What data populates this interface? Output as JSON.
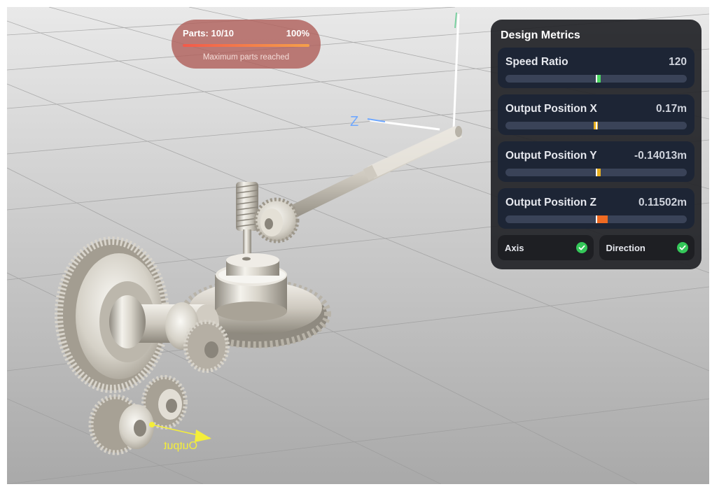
{
  "parts": {
    "label": "Parts: 10/10",
    "percent_label": "100%",
    "fill_fraction": 1.0,
    "message": "Maximum parts reached"
  },
  "metrics": {
    "title": "Design Metrics",
    "items": [
      {
        "label": "Speed Ratio",
        "value": "120",
        "indicator": 0.03,
        "color": "#4cd964"
      },
      {
        "label": "Output Position X",
        "value": "0.17m",
        "indicator": -0.03,
        "color": "#e8b020"
      },
      {
        "label": "Output Position Y",
        "value": "-0.14013m",
        "indicator": 0.03,
        "color": "#e8b020"
      },
      {
        "label": "Output Position Z",
        "value": "0.11502m",
        "indicator": 0.13,
        "color": "#ef6a22"
      }
    ],
    "checks": [
      {
        "label": "Axis",
        "status": "ok"
      },
      {
        "label": "Direction",
        "status": "ok"
      }
    ]
  },
  "scene": {
    "output_label": "Output",
    "axis_label": "Z"
  },
  "colors": {
    "pill_bg": "#b0605c",
    "panel_bg": "#222428",
    "check_green": "#34c759",
    "output_arrow": "#f4ee3a"
  }
}
